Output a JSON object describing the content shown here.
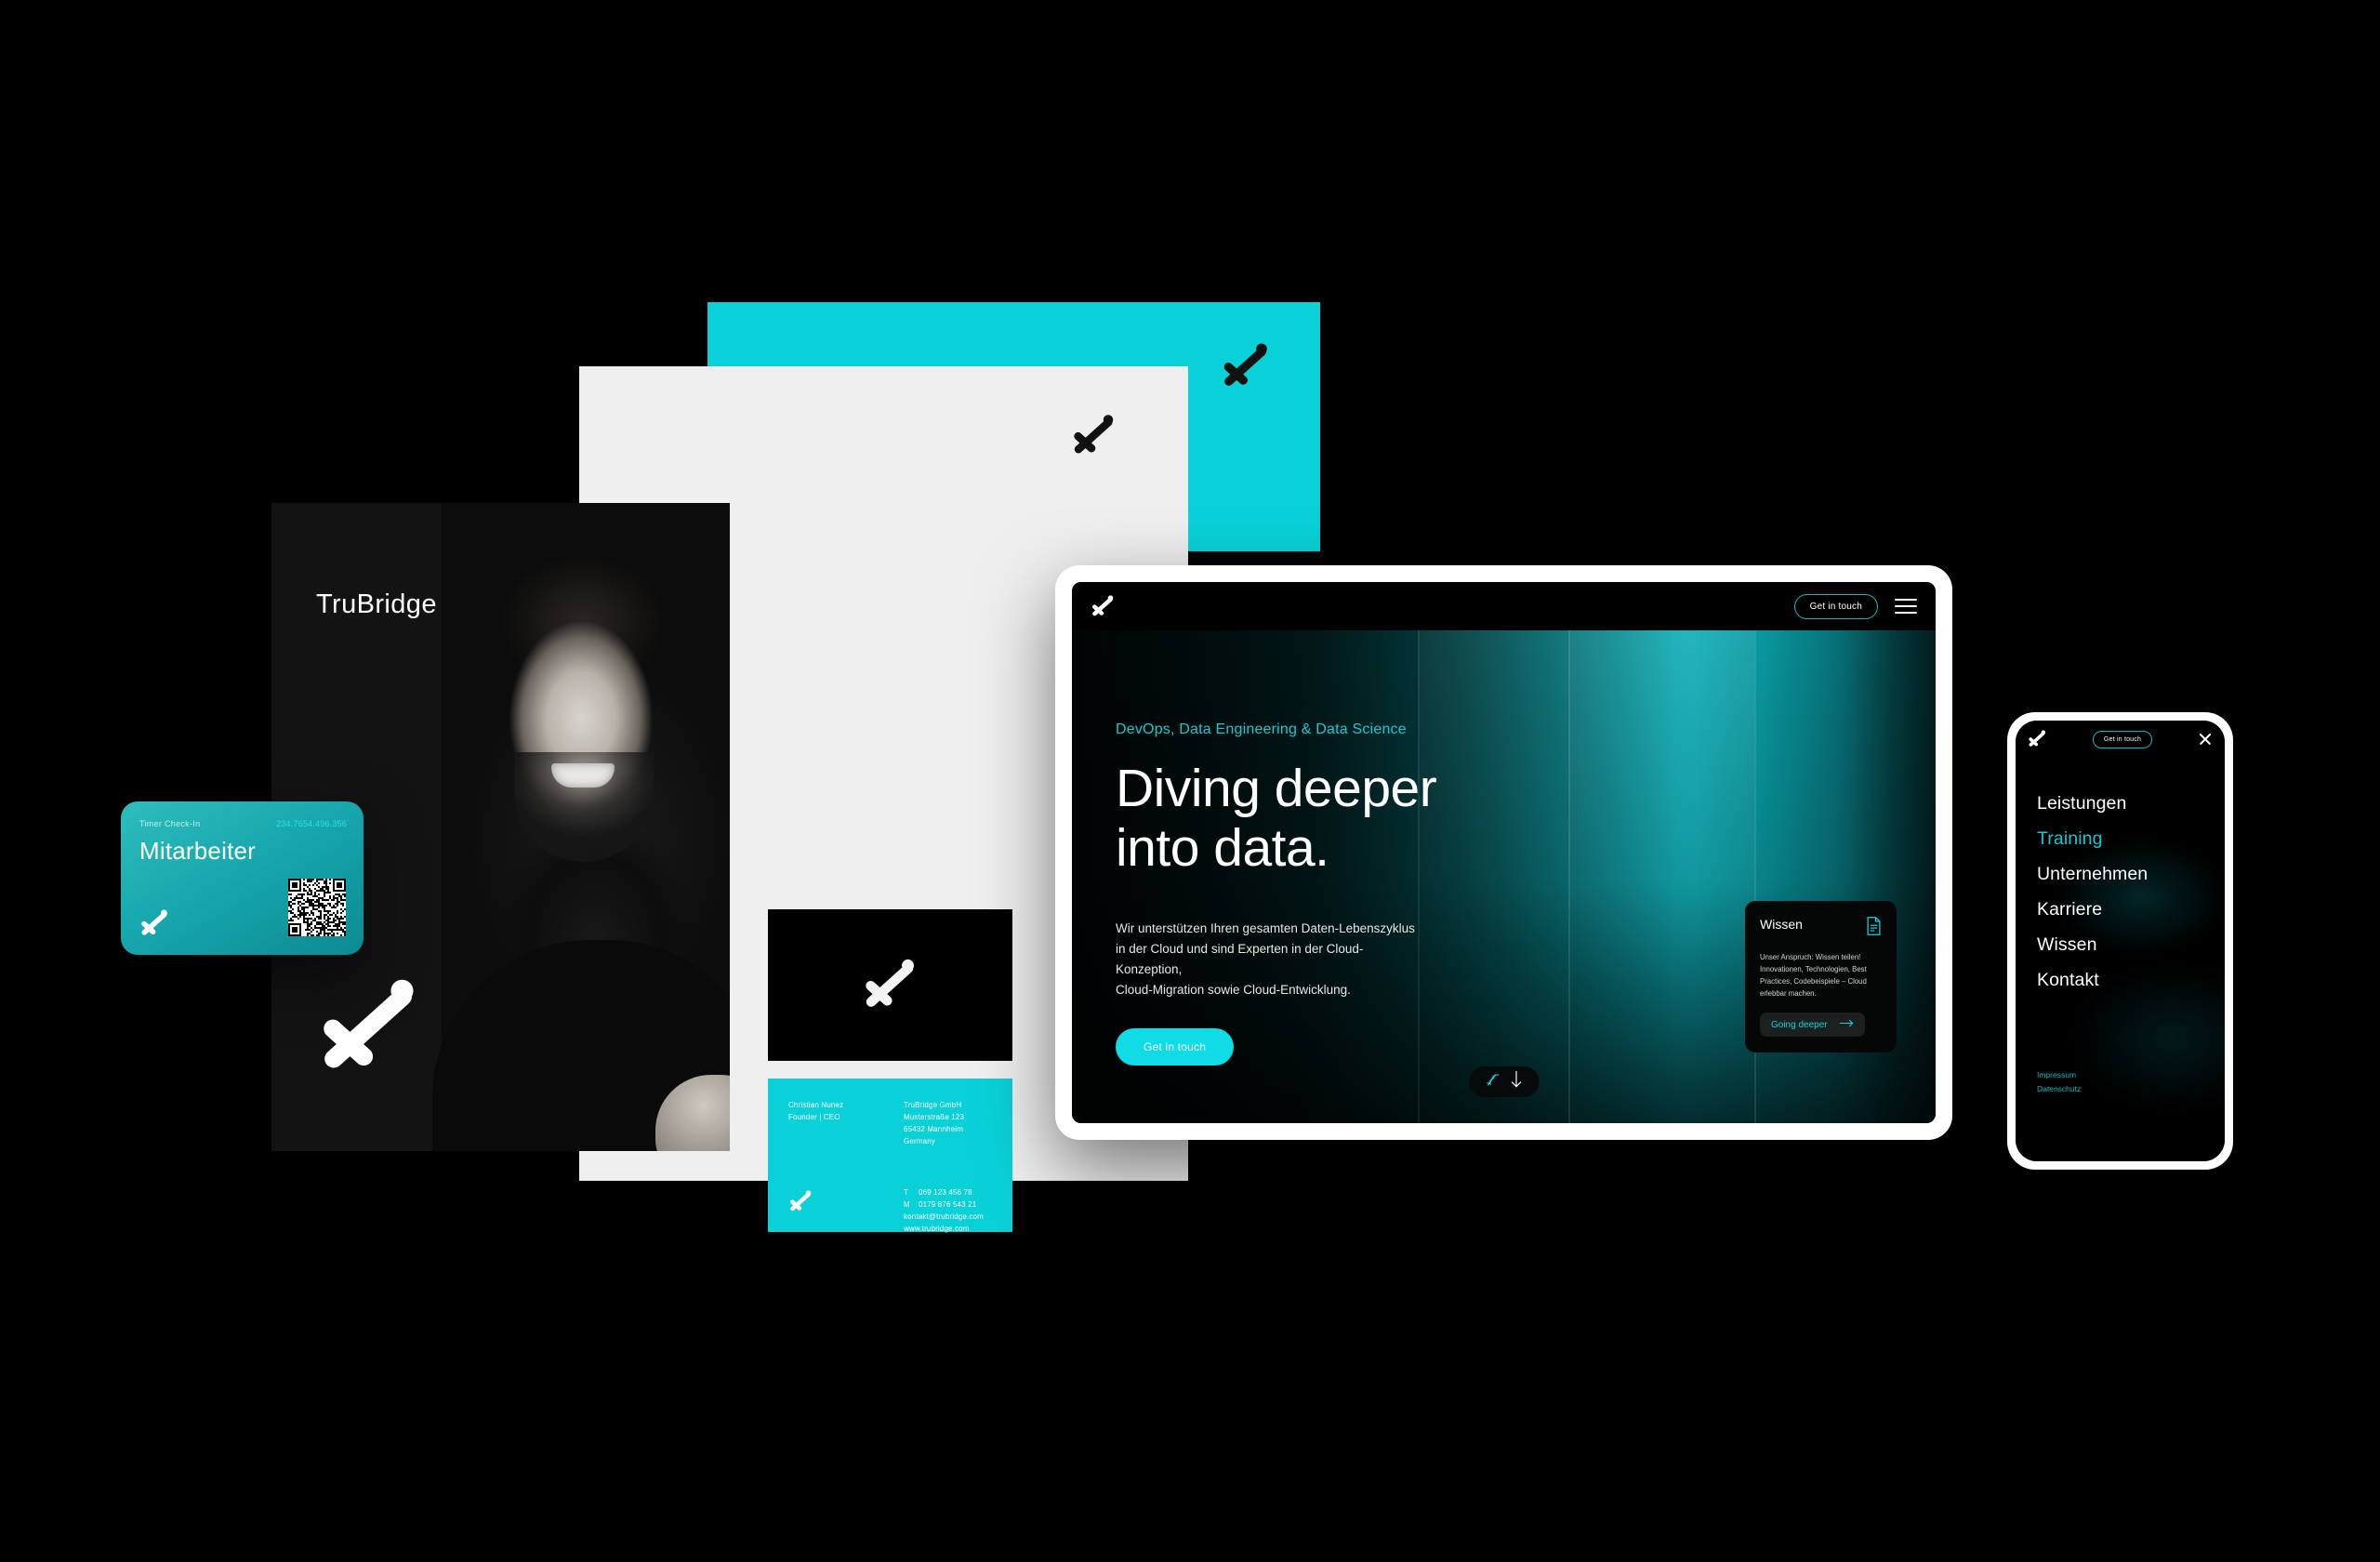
{
  "brand": {
    "name": "TruBridge",
    "logo_icon": "trubridge-x-mark-icon",
    "accent": "#0AD1D8",
    "accent_dark": "#12B9BF",
    "background": "#000000",
    "paper": "#EFEFEF",
    "poster_bg": "#131313"
  },
  "poster": {
    "title": "TruBridge",
    "logo_icon": "trubridge-x-mark-icon",
    "portrait_alt": "smiling-man-portrait"
  },
  "badge_card": {
    "label": "Timer Check-In",
    "number": "234.7654.496.356",
    "title": "Mitarbeiter",
    "qr_icon": "qr-code-icon",
    "logo_icon": "trubridge-x-mark-icon"
  },
  "black_card": {
    "logo_icon": "trubridge-x-mark-icon"
  },
  "business_card": {
    "person_name": "Christian Nunez",
    "person_role": "Founder | CEO",
    "company": "TruBridge GmbH",
    "street": "Musterstraße 123",
    "city": "65432 Mannheim",
    "country": "Germany",
    "phone_label": "T",
    "phone": "069 123 456 78",
    "mobile_label": "M",
    "mobile": "0179 876 543 21",
    "email": "kontakt@trubridge.com",
    "website": "www.trubridge.com",
    "logo_icon": "trubridge-x-mark-icon"
  },
  "tablet": {
    "topbar": {
      "logo_icon": "trubridge-x-mark-icon",
      "cta_label": "Get in touch",
      "menu_icon": "hamburger-menu-icon"
    },
    "hero": {
      "kicker": "DevOps, Data Engineering & Data Science",
      "headline_line1": "Diving deeper",
      "headline_line2": "into data.",
      "body_line1": "Wir unterstützen Ihren gesamten Daten-Lebenszyklus",
      "body_line2": "in der Cloud und sind Experten in der Cloud-Konzeption,",
      "body_line3": "Cloud-Migration sowie Cloud-Entwicklung.",
      "cta_label": "Get in touch"
    },
    "wissen_card": {
      "title": "Wissen",
      "icon": "document-icon",
      "body_line1": "Unser Anspruch: Wissen teilen!",
      "body_line2": "Innovationen, Technologien, Best",
      "body_line3": "Practices, Codebeispiele – Cloud",
      "body_line4": "erlebbar machen.",
      "link_label": "Going deeper",
      "link_icon": "arrow-right-icon"
    },
    "scroll_indicator": {
      "squiggle_icon": "squiggle-icon",
      "arrow_icon": "arrow-down-icon"
    }
  },
  "phone": {
    "topbar": {
      "logo_icon": "trubridge-x-mark-icon",
      "cta_label": "Get in touch",
      "close_icon": "close-icon"
    },
    "nav_items": [
      {
        "label": "Leistungen",
        "active": false
      },
      {
        "label": "Training",
        "active": true
      },
      {
        "label": "Unternehmen",
        "active": false
      },
      {
        "label": "Karriere",
        "active": false
      },
      {
        "label": "Wissen",
        "active": false
      },
      {
        "label": "Kontakt",
        "active": false
      }
    ],
    "footer_links": [
      {
        "label": "Impressum"
      },
      {
        "label": "Datenschutz"
      }
    ]
  }
}
